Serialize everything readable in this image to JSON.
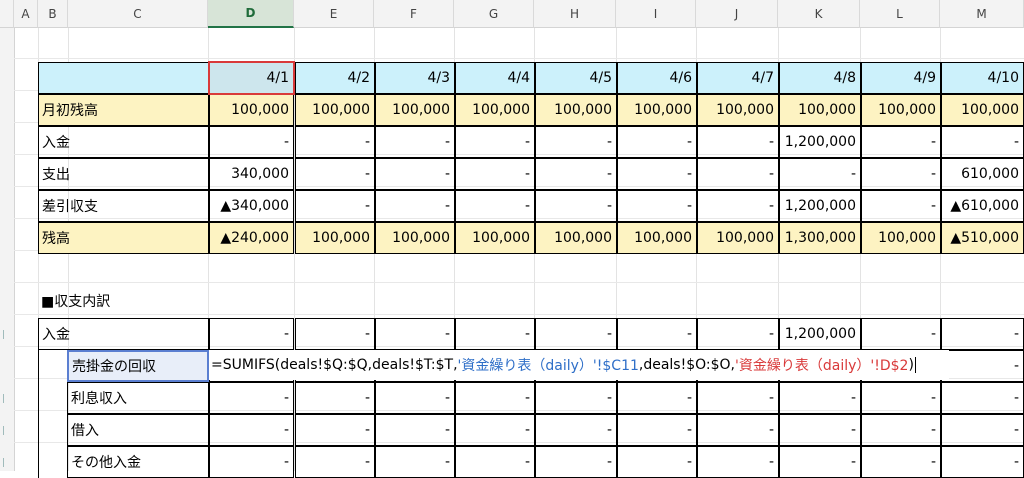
{
  "columns": [
    "A",
    "B",
    "C",
    "D",
    "E",
    "F",
    "G",
    "H",
    "I",
    "J",
    "K",
    "L",
    "M"
  ],
  "dates": [
    "4/1",
    "4/2",
    "4/3",
    "4/4",
    "4/5",
    "4/6",
    "4/7",
    "4/8",
    "4/9",
    "4/10"
  ],
  "summary": {
    "rows": [
      {
        "label": "月初残高",
        "style": "yellow",
        "values": [
          "100,000",
          "100,000",
          "100,000",
          "100,000",
          "100,000",
          "100,000",
          "100,000",
          "100,000",
          "100,000",
          "100,000"
        ]
      },
      {
        "label": "入金",
        "style": "plain",
        "values": [
          "-",
          "-",
          "-",
          "-",
          "-",
          "-",
          "-",
          "1,200,000",
          "-",
          "-"
        ]
      },
      {
        "label": "支出",
        "style": "plain",
        "values": [
          "340,000",
          "-",
          "-",
          "-",
          "-",
          "-",
          "-",
          "-",
          "-",
          "610,000"
        ]
      },
      {
        "label": "差引収支",
        "style": "plain",
        "values": [
          "▲340,000",
          "-",
          "-",
          "-",
          "-",
          "-",
          "-",
          "1,200,000",
          "-",
          "▲610,000"
        ]
      },
      {
        "label": "残高",
        "style": "yellow",
        "values": [
          "▲240,000",
          "100,000",
          "100,000",
          "100,000",
          "100,000",
          "100,000",
          "100,000",
          "1,300,000",
          "100,000",
          "▲510,000"
        ]
      }
    ]
  },
  "section_title": "■収支内訳",
  "detail": {
    "header": {
      "label": "入金",
      "values": [
        "-",
        "-",
        "-",
        "-",
        "-",
        "-",
        "-",
        "1,200,000",
        "-",
        "-"
      ]
    },
    "rows": [
      {
        "label": "売掛金の回収",
        "values": [
          "",
          "",
          "",
          "",
          "",
          "",
          "",
          "",
          "",
          "-"
        ]
      },
      {
        "label": "利息収入",
        "values": [
          "-",
          "-",
          "-",
          "-",
          "-",
          "-",
          "-",
          "-",
          "-",
          "-"
        ]
      },
      {
        "label": "借入",
        "values": [
          "-",
          "-",
          "-",
          "-",
          "-",
          "-",
          "-",
          "-",
          "-",
          "-"
        ]
      },
      {
        "label": "その他入金",
        "values": [
          "-",
          "-",
          "-",
          "-",
          "-",
          "-",
          "-",
          "-",
          "-",
          "-"
        ]
      }
    ]
  },
  "formula": {
    "p1": "=SUMIFS(deals!$Q:$Q,deals!$T:$T,",
    "p2": "'資金繰り表（daily）'!$C11",
    "p3": ",deals!$O:$O,",
    "p4": "'資金繰り表（daily）'!D$2",
    "p5": ")"
  },
  "colors": {
    "blue_header": "#ccf1fb",
    "yellow_row": "#fdf3c2",
    "selection": "#217346",
    "ref_blue": "#2f6fc8",
    "ref_red": "#d93a3a"
  }
}
